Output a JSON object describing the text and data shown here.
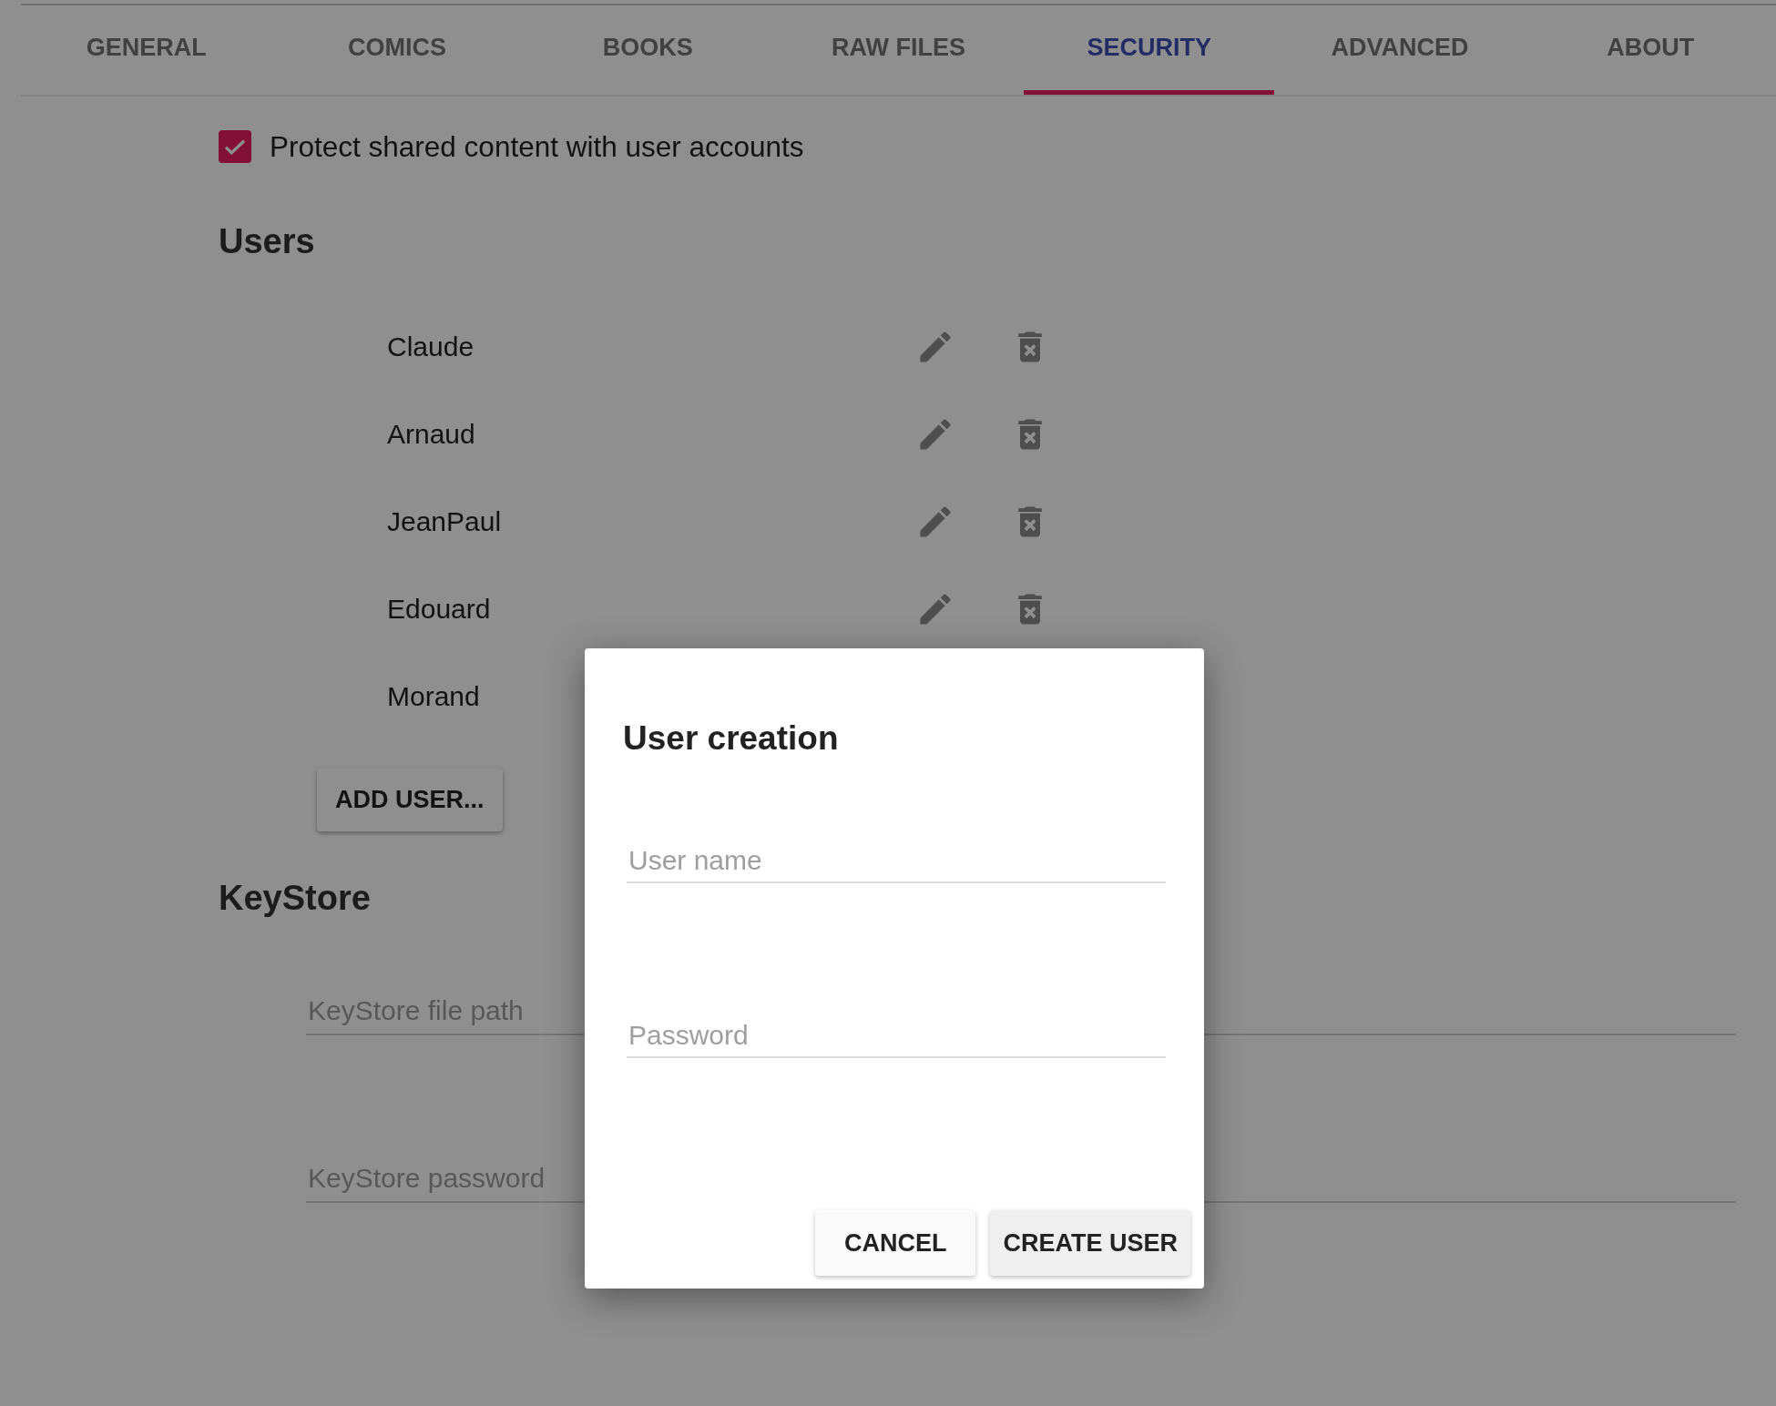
{
  "tabs": [
    {
      "label": "GENERAL",
      "selected": false
    },
    {
      "label": "COMICS",
      "selected": false
    },
    {
      "label": "BOOKS",
      "selected": false
    },
    {
      "label": "RAW FILES",
      "selected": false
    },
    {
      "label": "SECURITY",
      "selected": true
    },
    {
      "label": "ADVANCED",
      "selected": false
    },
    {
      "label": "ABOUT",
      "selected": false
    }
  ],
  "protect_checkbox": {
    "label": "Protect shared content with user accounts",
    "checked": true
  },
  "users_section": {
    "heading": "Users",
    "users": [
      {
        "name": "Claude"
      },
      {
        "name": "Arnaud"
      },
      {
        "name": "JeanPaul"
      },
      {
        "name": "Edouard"
      },
      {
        "name": "Morand"
      }
    ],
    "add_button": "ADD USER..."
  },
  "keystore_section": {
    "heading": "KeyStore",
    "fields": [
      {
        "placeholder": "KeyStore file path"
      },
      {
        "placeholder": "KeyStore password"
      }
    ]
  },
  "dialog": {
    "title": "User creation",
    "fields": [
      {
        "placeholder": "User name"
      },
      {
        "placeholder": "Password"
      }
    ],
    "buttons": [
      {
        "label": "CANCEL",
        "kind": "flat"
      },
      {
        "label": "CREATE USER",
        "kind": "primary"
      }
    ]
  }
}
